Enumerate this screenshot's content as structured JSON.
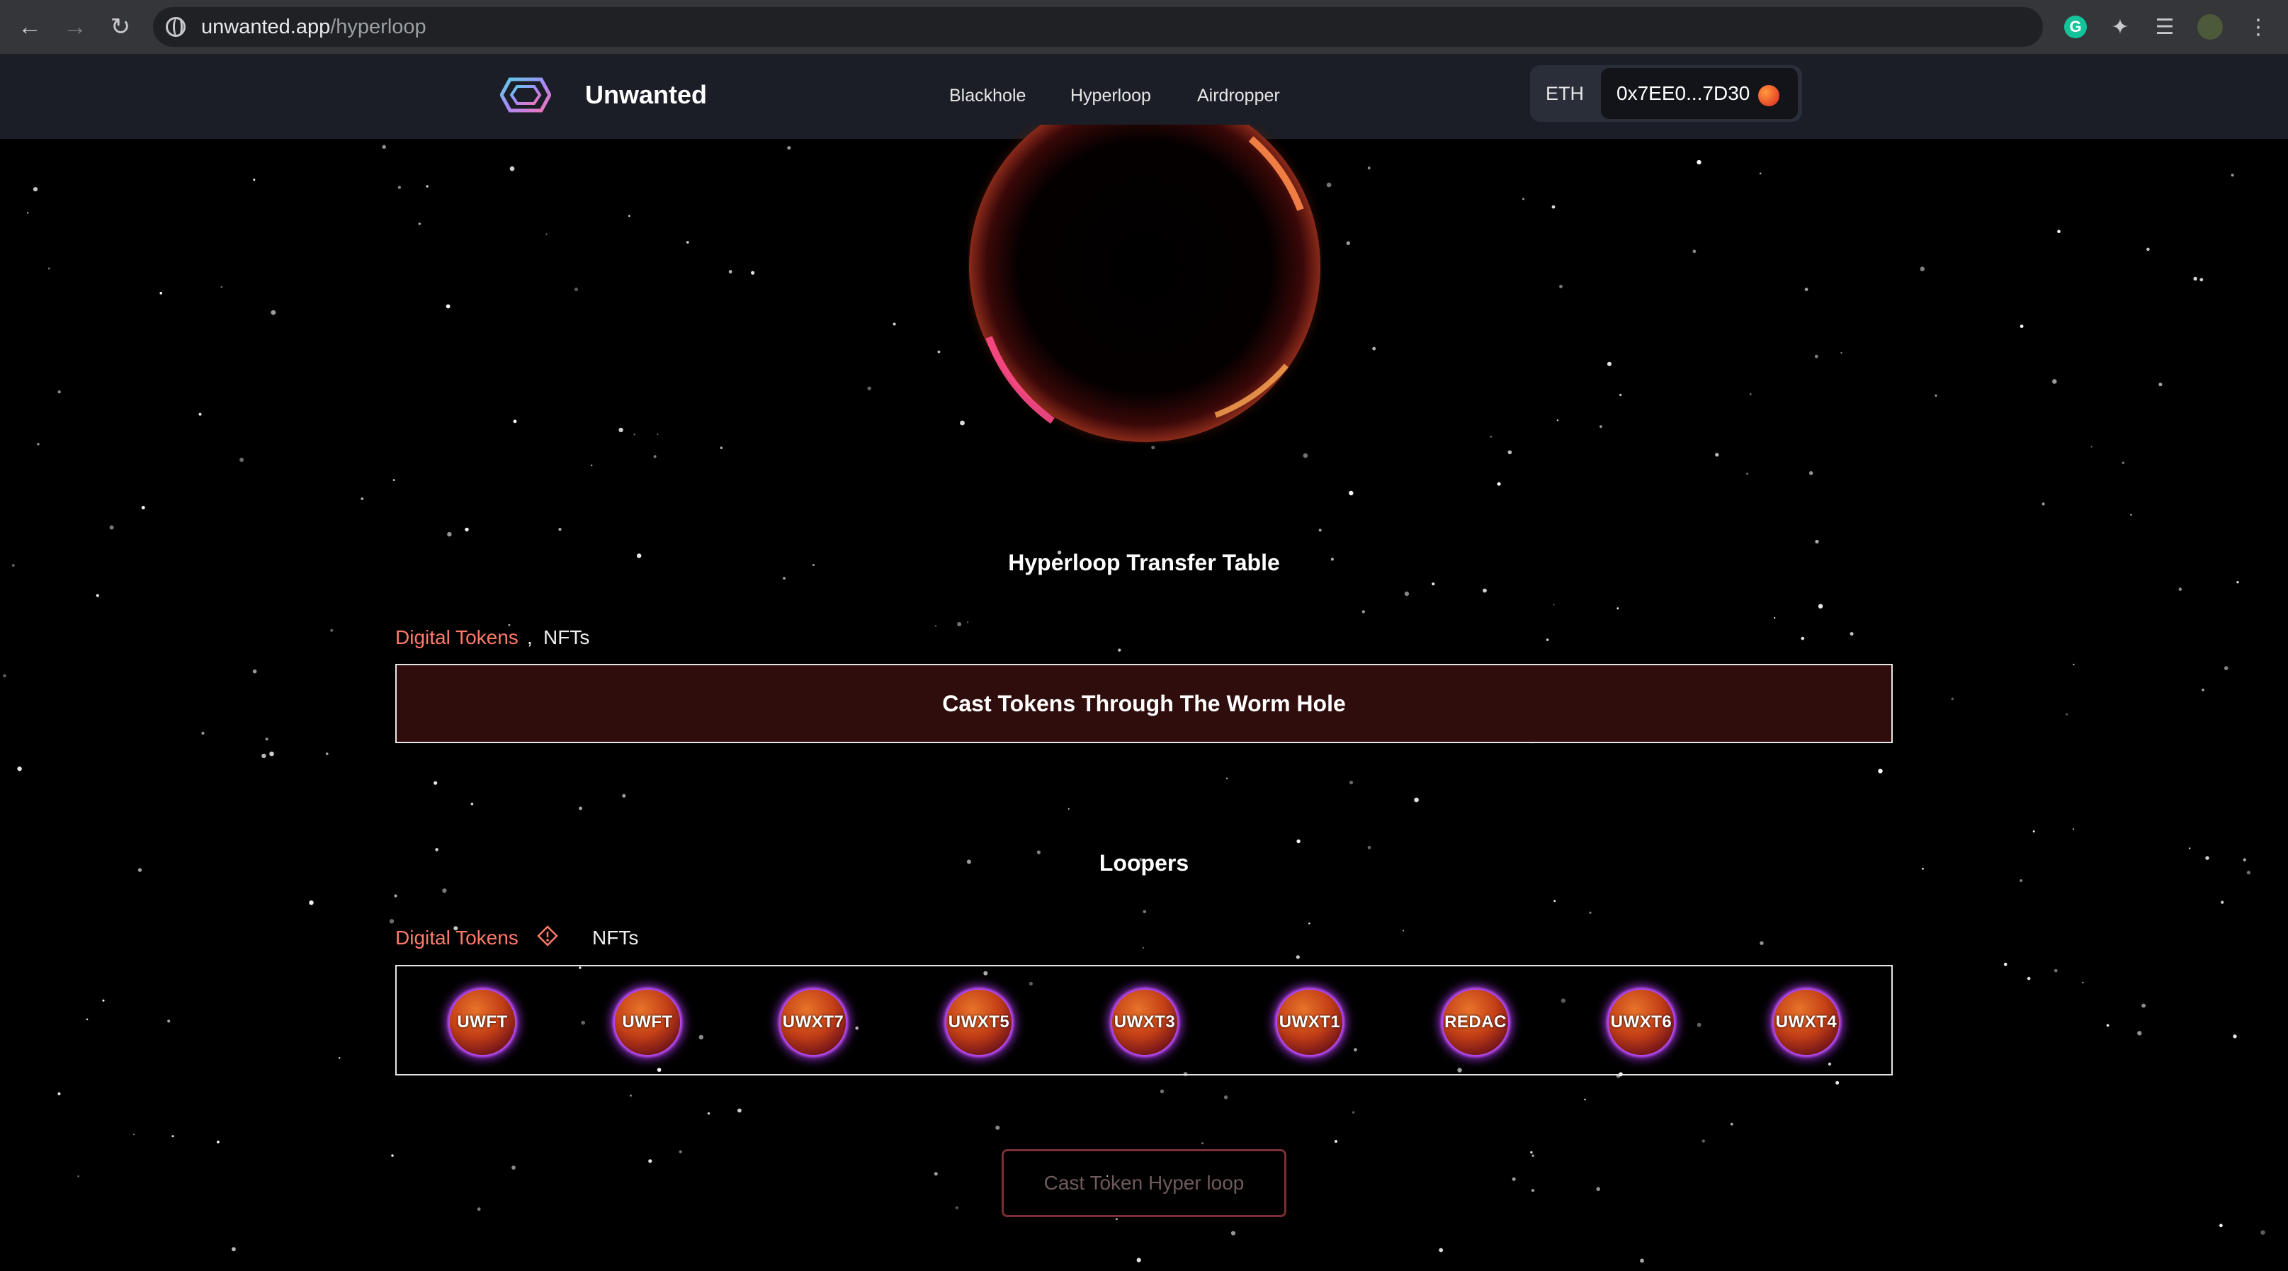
{
  "browser": {
    "back_icon": "arrow-left-icon",
    "forward_icon": "arrow-right-icon",
    "reload_icon": "reload-icon",
    "url_domain": "unwanted.app",
    "url_path": "/hyperloop",
    "extensions": [
      "grammarly-icon",
      "puzzle-icon",
      "media-queue-icon",
      "profile-avatar",
      "menu-icon"
    ]
  },
  "header": {
    "brand": "Unwanted",
    "nav": [
      "Blackhole",
      "Hyperloop",
      "Airdropper"
    ],
    "network": "ETH",
    "account": "0x7EE0...7D30"
  },
  "transfer": {
    "title": "Hyperloop Transfer Table",
    "tabs": [
      "Digital Tokens",
      "NFTs"
    ],
    "separator": ",",
    "box_text": "Cast Tokens Through The Worm Hole"
  },
  "loopers": {
    "title": "Loopers",
    "tabs": [
      "Digital Tokens",
      "NFTs"
    ],
    "tokens": [
      "UWFT",
      "UWFT",
      "UWXT7",
      "UWXT5",
      "UWXT3",
      "UWXT1",
      "REDAC",
      "UWXT6",
      "UWXT4"
    ]
  },
  "cast_button": "Cast Token Hyper loop",
  "colors": {
    "accent": "#ff7a6a",
    "header_bg": "#1b1e26",
    "transfer_box_bg": "#300d0d",
    "token_glow": "#ba3cff"
  }
}
